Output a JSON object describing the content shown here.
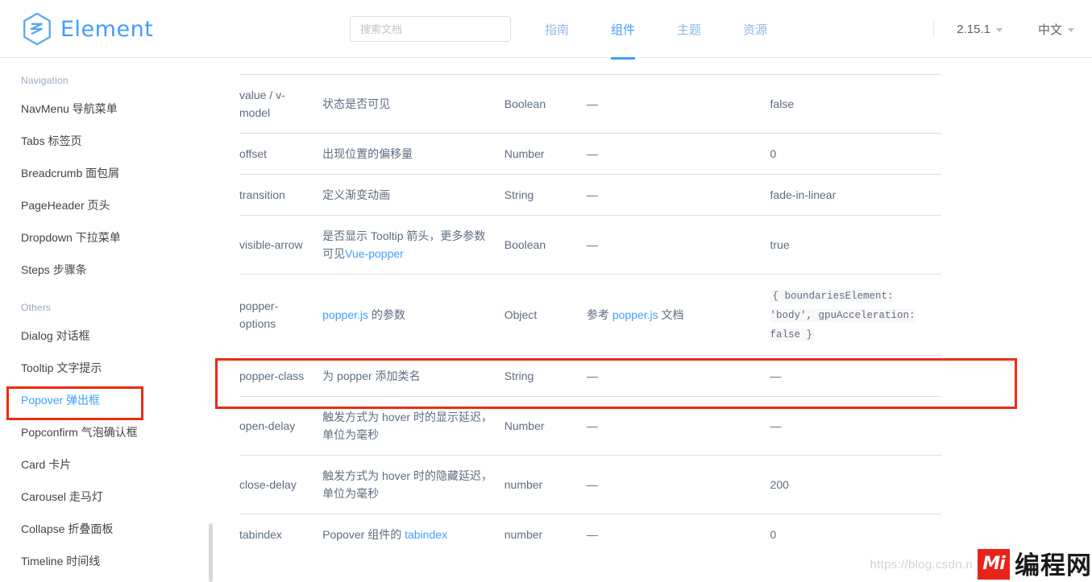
{
  "header": {
    "brand": "Element",
    "logo_icon": "element-hexagon-logo",
    "search": {
      "placeholder": "搜索文档",
      "value": ""
    },
    "nav": [
      {
        "label": "指南",
        "active": false
      },
      {
        "label": "组件",
        "active": true
      },
      {
        "label": "主题",
        "active": false
      },
      {
        "label": "资源",
        "active": false
      }
    ],
    "version": "2.15.1",
    "language": "中文"
  },
  "sidebar": {
    "groups": [
      {
        "title": "Navigation",
        "items": [
          {
            "label": "NavMenu 导航菜单",
            "active": false
          },
          {
            "label": "Tabs 标签页",
            "active": false
          },
          {
            "label": "Breadcrumb 面包屑",
            "active": false
          },
          {
            "label": "PageHeader 页头",
            "active": false
          },
          {
            "label": "Dropdown 下拉菜单",
            "active": false
          },
          {
            "label": "Steps 步骤条",
            "active": false
          }
        ]
      },
      {
        "title": "Others",
        "items": [
          {
            "label": "Dialog 对话框",
            "active": false
          },
          {
            "label": "Tooltip 文字提示",
            "active": false
          },
          {
            "label": "Popover 弹出框",
            "active": true
          },
          {
            "label": "Popconfirm 气泡确认框",
            "active": false
          },
          {
            "label": "Card 卡片",
            "active": false
          },
          {
            "label": "Carousel 走马灯",
            "active": false
          },
          {
            "label": "Collapse 折叠面板",
            "active": false
          },
          {
            "label": "Timeline 时间线",
            "active": false
          }
        ]
      }
    ]
  },
  "table": {
    "rows": [
      {
        "param": "value / v-model",
        "desc": "状态是否可见",
        "type": "Boolean",
        "accepted": "—",
        "default": "false"
      },
      {
        "param": "offset",
        "desc": "出现位置的偏移量",
        "type": "Number",
        "accepted": "—",
        "default": "0"
      },
      {
        "param": "transition",
        "desc": "定义渐变动画",
        "type": "String",
        "accepted": "—",
        "default": "fade-in-linear"
      },
      {
        "param": "visible-arrow",
        "desc_pre": "是否显示 Tooltip 箭头，更多参数可见",
        "desc_link": "Vue-popper",
        "type": "Boolean",
        "accepted": "—",
        "default": "true"
      },
      {
        "param": "popper-options",
        "desc_link": "popper.js",
        "desc_post": " 的参数",
        "type": "Object",
        "accepted_pre": "参考 ",
        "accepted_link": "popper.js",
        "accepted_post": " 文档",
        "default_code": "{ boundariesElement: 'body', gpuAcceleration: false }"
      },
      {
        "param": "popper-class",
        "desc": "为 popper 添加类名",
        "type": "String",
        "accepted": "—",
        "default": "—",
        "highlighted": true
      },
      {
        "param": "open-delay",
        "desc": "触发方式为 hover 时的显示延迟，单位为毫秒",
        "type": "Number",
        "accepted": "—",
        "default": "—"
      },
      {
        "param": "close-delay",
        "desc": "触发方式为 hover 时的隐藏延迟，单位为毫秒",
        "type": "number",
        "accepted": "—",
        "default": "200"
      },
      {
        "param": "tabindex",
        "desc_pre": "Popover 组件的 ",
        "desc_link": "tabindex",
        "type": "number",
        "accepted": "—",
        "default": "0"
      }
    ]
  },
  "annotations": {
    "color": "#ee2b12",
    "boxes": [
      {
        "name": "sidebar-popover-highlight"
      },
      {
        "name": "popper-class-row-highlight"
      }
    ]
  },
  "watermark": {
    "url": "https://blog.csdn.n",
    "logo_text": "Mi",
    "brand": "编程网"
  }
}
